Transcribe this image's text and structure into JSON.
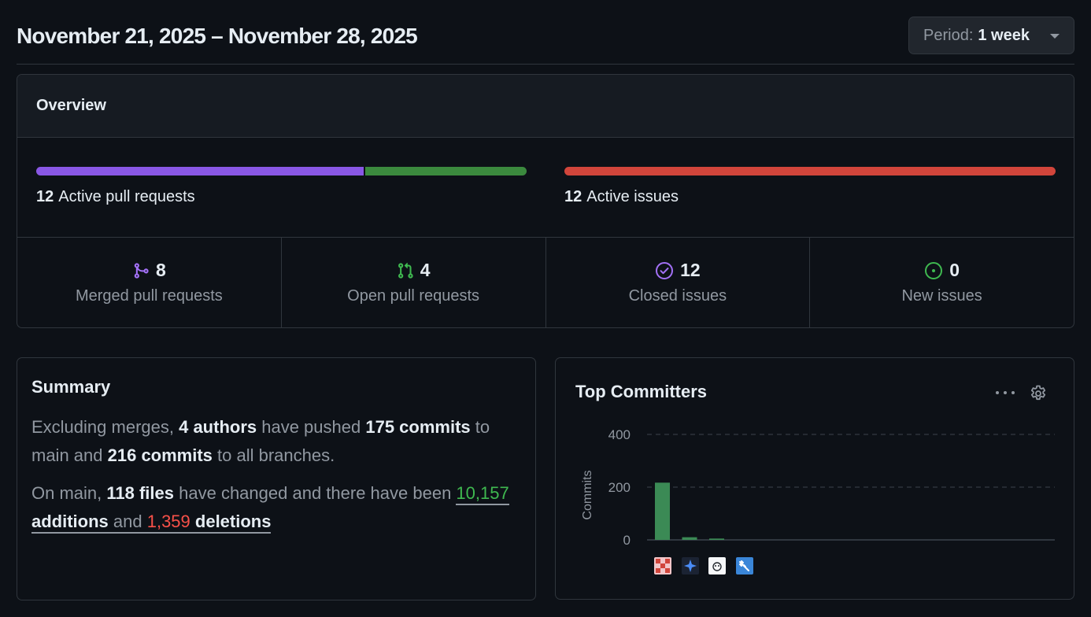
{
  "header": {
    "title": "November 21, 2025 – November 28, 2025",
    "period_label": "Period:",
    "period_value": "1 week"
  },
  "overview": {
    "title": "Overview",
    "pull_requests": {
      "count": "12",
      "label": "Active pull requests",
      "merged_fraction": 0.667,
      "open_fraction": 0.333
    },
    "issues": {
      "count": "12",
      "label": "Active issues",
      "closed_fraction": 1.0
    },
    "stats": [
      {
        "icon": "merged-pr-icon",
        "value": "8",
        "label": "Merged pull requests"
      },
      {
        "icon": "open-pr-icon",
        "value": "4",
        "label": "Open pull requests"
      },
      {
        "icon": "closed-issue-icon",
        "value": "12",
        "label": "Closed issues"
      },
      {
        "icon": "new-issue-icon",
        "value": "0",
        "label": "New issues"
      }
    ]
  },
  "summary": {
    "title": "Summary",
    "p1_a": "Excluding merges, ",
    "authors": "4 authors",
    "p1_b": " have pushed ",
    "commits_main": "175 commits",
    "p1_c": " to main and ",
    "commits_all": "216 commits",
    "p1_d": " to all branches.",
    "p2_a": "On main, ",
    "files": "118 files",
    "p2_b": " have changed and there have been ",
    "additions_num": "10,157",
    "additions_word": " additions",
    "p2_c": " and ",
    "deletions_num": "1,359",
    "deletions_word": " deletions"
  },
  "committers": {
    "title": "Top Committers",
    "menu_icon": "kebab-horizontal-icon",
    "settings_icon": "gear-icon",
    "colors": {
      "bar": "#3b8a55",
      "grid": "#3d444d",
      "text": "#9198a1"
    }
  },
  "chart_data": {
    "type": "bar",
    "ylabel": "Commits",
    "ylim": [
      0,
      400
    ],
    "yticks": [
      0,
      200,
      400
    ],
    "categories": [
      "committer-1",
      "committer-2",
      "committer-3",
      "committer-4"
    ],
    "values": [
      217,
      10,
      5,
      0
    ],
    "grid": true
  }
}
